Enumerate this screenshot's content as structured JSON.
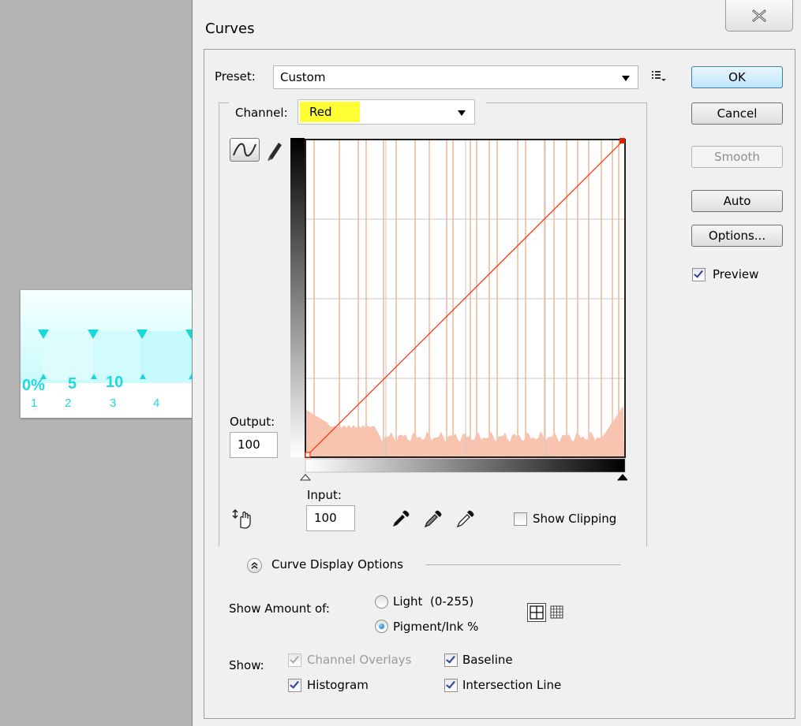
{
  "background_doc": {
    "percent_labels": [
      "0%",
      "5",
      "10"
    ],
    "index_labels": [
      "1",
      "2",
      "3",
      "4"
    ]
  },
  "dialog": {
    "title": "Curves",
    "close_glyph": "close-x-icon",
    "preset_label": "Preset:",
    "preset_value": "Custom",
    "channel_label": "Channel:",
    "channel_value": "Red",
    "channel_highlight": "#ffff33",
    "buttons": {
      "ok": "OK",
      "cancel": "Cancel",
      "smooth": "Smooth",
      "auto": "Auto",
      "options": "Options..."
    },
    "preview_label": "Preview",
    "preview_checked": true,
    "output_label": "Output:",
    "output_value": "100",
    "input_label": "Input:",
    "input_value": "100",
    "show_clipping_label": "Show Clipping",
    "show_clipping_checked": false,
    "curve_display_options_label": "Curve Display Options",
    "show_amount_label": "Show Amount of:",
    "light_label": "Light  (0-255)",
    "pigment_label": "Pigment/Ink %",
    "selected_amount": "pigment",
    "show_label": "Show:",
    "channel_overlays_label": "Channel Overlays",
    "baseline_label": "Baseline",
    "histogram_label": "Histogram",
    "intersection_line_label": "Intersection Line",
    "curve_color": "#ff2a00",
    "histogram_color": "#f8c4b0",
    "grid_line_color": "#f4c9b0"
  }
}
